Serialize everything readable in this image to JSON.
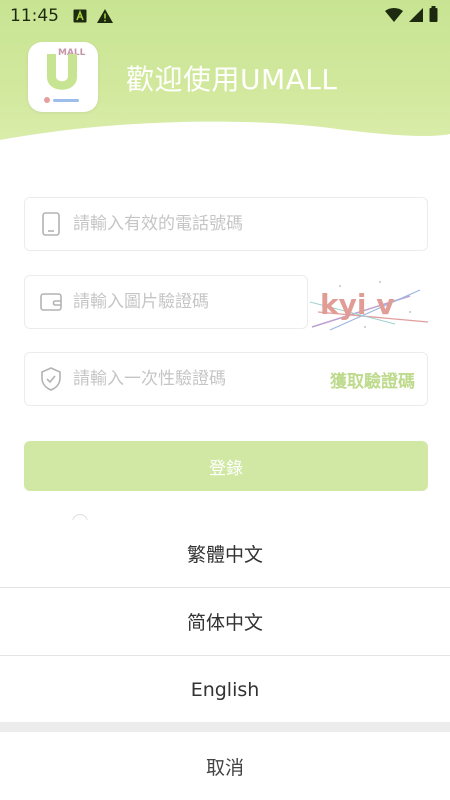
{
  "status_bar": {
    "time": "11:45",
    "icons": [
      "a-app-icon",
      "warning-icon",
      "wifi-icon",
      "signal-icon",
      "battery-icon"
    ]
  },
  "header": {
    "logo_text": "MALL",
    "welcome": "歡迎使用UMALL"
  },
  "form": {
    "phone_placeholder": "請輸入有效的電話號碼",
    "image_code_placeholder": "請輸入圖片驗證碼",
    "otp_placeholder": "請輸入一次性驗證碼",
    "get_code_label": "獲取驗證碼",
    "captcha_text": "kyi v",
    "login_label": "登錄"
  },
  "language_sheet": {
    "options": [
      {
        "label": "繁體中文"
      },
      {
        "label": "简体中文"
      },
      {
        "label": "English"
      }
    ],
    "cancel_label": "取消"
  },
  "colors": {
    "brand_green": "#8fc926",
    "accent_green": "#7cb518",
    "login_button": "#a2d14a"
  }
}
